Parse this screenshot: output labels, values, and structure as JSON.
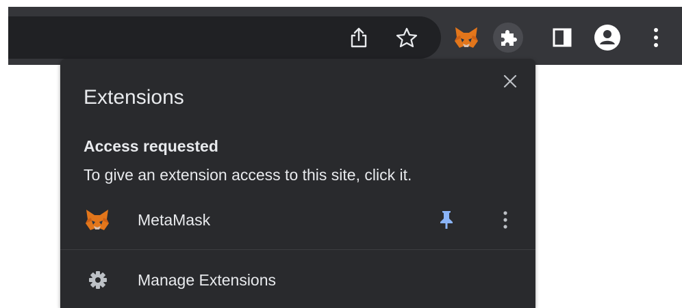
{
  "toolbar": {
    "icons": [
      "share-icon",
      "star-icon",
      "metamask-fox-icon",
      "puzzle-icon",
      "side-panel-icon",
      "profile-icon",
      "kebab-menu-icon"
    ]
  },
  "popup": {
    "title": "Extensions",
    "close_icon": "close-icon",
    "section": {
      "heading": "Access requested",
      "description": "To give an extension access to this site, click it."
    },
    "extensions": [
      {
        "name": "MetaMask",
        "icon": "metamask-fox-icon",
        "pinned": true
      }
    ],
    "manage_label": "Manage Extensions"
  },
  "colors": {
    "toolbar_bg": "#35363a",
    "omnibox_bg": "#202124",
    "popup_bg": "#292a2d",
    "text": "#e8eaed",
    "pin_accent": "#8ab4f8",
    "fox_orange": "#e2761b"
  }
}
